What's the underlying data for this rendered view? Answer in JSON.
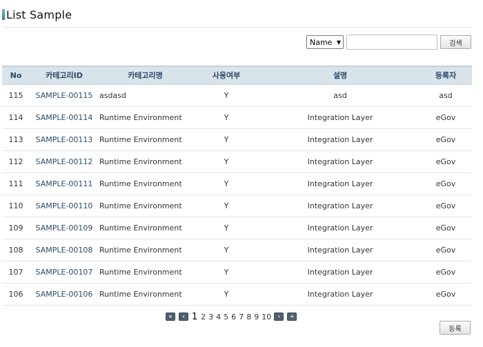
{
  "page": {
    "title": "List Sample"
  },
  "search": {
    "select_value": "Name",
    "input_value": "",
    "button_label": "검색"
  },
  "table": {
    "headers": [
      "No",
      "카테고리ID",
      "카테고리명",
      "사용여부",
      "설명",
      "등록자"
    ],
    "rows": [
      {
        "no": "115",
        "id": "SAMPLE-00115",
        "name": "asdasd",
        "use": "Y",
        "desc": "asd",
        "reg": "asd"
      },
      {
        "no": "114",
        "id": "SAMPLE-00114",
        "name": "Runtime Environment",
        "use": "Y",
        "desc": "Integration Layer",
        "reg": "eGov"
      },
      {
        "no": "113",
        "id": "SAMPLE-00113",
        "name": "Runtime Environment",
        "use": "Y",
        "desc": "Integration Layer",
        "reg": "eGov"
      },
      {
        "no": "112",
        "id": "SAMPLE-00112",
        "name": "Runtime Environment",
        "use": "Y",
        "desc": "Integration Layer",
        "reg": "eGov"
      },
      {
        "no": "111",
        "id": "SAMPLE-00111",
        "name": "Runtime Environment",
        "use": "Y",
        "desc": "Integration Layer",
        "reg": "eGov"
      },
      {
        "no": "110",
        "id": "SAMPLE-00110",
        "name": "Runtime Environment",
        "use": "Y",
        "desc": "Integration Layer",
        "reg": "eGov"
      },
      {
        "no": "109",
        "id": "SAMPLE-00109",
        "name": "Runtime Environment",
        "use": "Y",
        "desc": "Integration Layer",
        "reg": "eGov"
      },
      {
        "no": "108",
        "id": "SAMPLE-00108",
        "name": "Runtime Environment",
        "use": "Y",
        "desc": "Integration Layer",
        "reg": "eGov"
      },
      {
        "no": "107",
        "id": "SAMPLE-00107",
        "name": "Runtime Environment",
        "use": "Y",
        "desc": "Integration Layer",
        "reg": "eGov"
      },
      {
        "no": "106",
        "id": "SAMPLE-00106",
        "name": "Runtime Environment",
        "use": "Y",
        "desc": "Integration Layer",
        "reg": "eGov"
      }
    ]
  },
  "pagination": {
    "first_label": "«",
    "prev_label": "‹",
    "next_label": "›",
    "last_label": "»",
    "pages": [
      "1",
      "2",
      "3",
      "4",
      "5",
      "6",
      "7",
      "8",
      "9",
      "10"
    ],
    "current": "1"
  },
  "actions": {
    "register_label": "등록"
  }
}
